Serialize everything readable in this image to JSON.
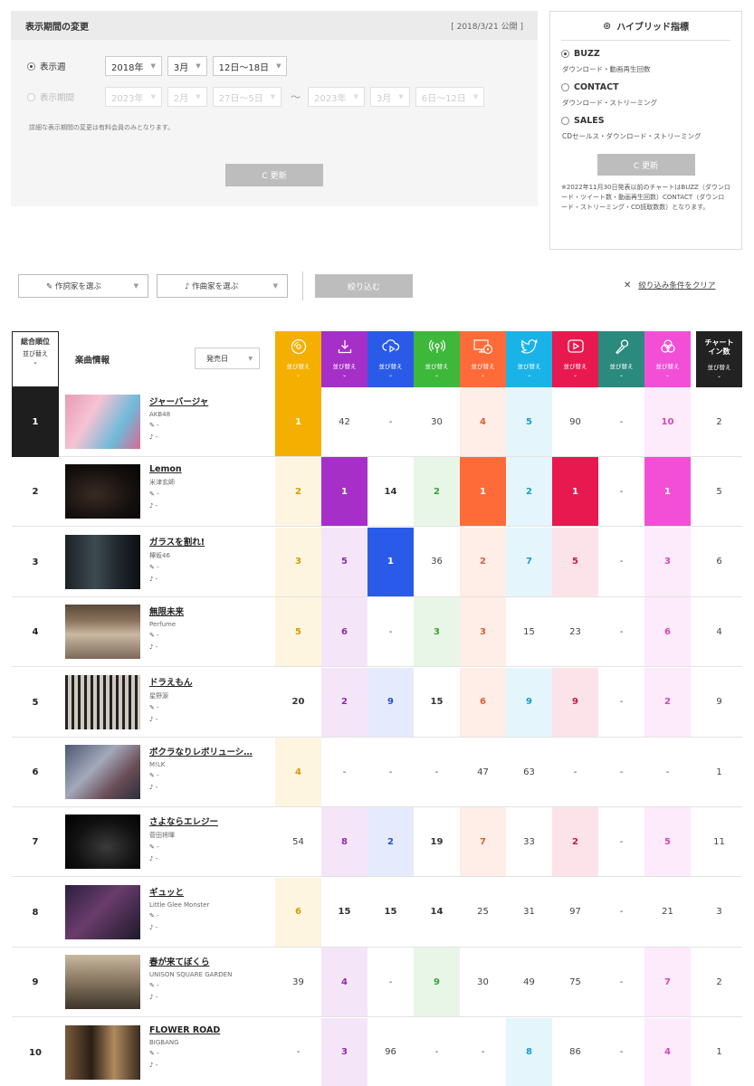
{
  "period": {
    "title": "表示期間の変更",
    "published": "[ 2018/3/21 公開 ]",
    "week_label": "表示週",
    "year": "2018年",
    "month": "3月",
    "week": "12日〜18日",
    "range_label": "表示期間",
    "range_from_year": "2023年",
    "range_from_month": "2月",
    "range_from_days": "27日〜5日",
    "tilde": "〜",
    "range_to_year": "2023年",
    "range_to_month": "3月",
    "range_to_days": "6日〜12日",
    "note": "詳細な表示期間の変更は有料会員のみとなります。",
    "update": "C 更新"
  },
  "hybrid": {
    "title": "ハイブリッド指標",
    "options": [
      {
        "label": "BUZZ",
        "desc": "ダウンロード・動画再生回数",
        "selected": true
      },
      {
        "label": "CONTACT",
        "desc": "ダウンロード・ストリーミング",
        "selected": false
      },
      {
        "label": "SALES",
        "desc": "CDセールス・ダウンロード・ストリーミング",
        "selected": false
      }
    ],
    "update": "C 更新",
    "note": "※2022年11月30日発表以前のチャートはBUZZ（ダウンロード・ツイート数・動画再生回数）CONTACT（ダウンロード・ストリーミング・CD読取数数）となります。"
  },
  "filters": {
    "lyricist": "作詞家を選ぶ",
    "composer": "作曲家を選ぶ",
    "apply": "絞り込む",
    "clear": "絞り込み条件をクリア"
  },
  "table": {
    "rank_header": "総合順位",
    "sort_label": "並び替え",
    "info_header": "楽曲情報",
    "release_sort": "発売日",
    "chart_in": "チャートイン数",
    "metrics": [
      {
        "name": "cd-sales",
        "icon": "disc-icon",
        "color": "#F5AF00"
      },
      {
        "name": "download",
        "icon": "download-icon",
        "color": "#A62FC8"
      },
      {
        "name": "streaming",
        "icon": "cloud-play-icon",
        "color": "#2A5BE8"
      },
      {
        "name": "radio",
        "icon": "radio-icon",
        "color": "#3DB83B"
      },
      {
        "name": "pc-read",
        "icon": "pc-disc-icon",
        "color": "#FF6B38"
      },
      {
        "name": "twitter",
        "icon": "bird-icon",
        "color": "#1AB3E8"
      },
      {
        "name": "video",
        "icon": "play-icon",
        "color": "#E8194E"
      },
      {
        "name": "karaoke",
        "icon": "mic-icon",
        "color": "#2A8A7D"
      },
      {
        "name": "gyao",
        "icon": "disc-cluster-icon",
        "color": "#F24FD6"
      },
      {
        "name": "chart-in",
        "icon": "",
        "color": "#222222"
      }
    ],
    "rows": [
      {
        "rank": "1",
        "title": "ジャーバージャ",
        "artist": "AKB48",
        "vals": [
          "1",
          "42",
          "-",
          "30",
          "4",
          "5",
          "90",
          "-",
          "10",
          "2"
        ]
      },
      {
        "rank": "2",
        "title": "Lemon",
        "artist": "米津玄師",
        "vals": [
          "2",
          "1",
          "14",
          "2",
          "1",
          "2",
          "1",
          "-",
          "1",
          "5"
        ]
      },
      {
        "rank": "3",
        "title": "ガラスを割れ!",
        "artist": "欅坂46",
        "vals": [
          "3",
          "5",
          "1",
          "36",
          "2",
          "7",
          "5",
          "-",
          "3",
          "6"
        ]
      },
      {
        "rank": "4",
        "title": "無限未来",
        "artist": "Perfume",
        "vals": [
          "5",
          "6",
          "-",
          "3",
          "3",
          "15",
          "23",
          "-",
          "6",
          "4"
        ]
      },
      {
        "rank": "5",
        "title": "ドラえもん",
        "artist": "星野源",
        "vals": [
          "20",
          "2",
          "9",
          "15",
          "6",
          "9",
          "9",
          "-",
          "2",
          "9"
        ]
      },
      {
        "rank": "6",
        "title": "ボクラなりレボリューシ…",
        "artist": "M!LK",
        "vals": [
          "4",
          "-",
          "-",
          "-",
          "47",
          "63",
          "-",
          "-",
          "-",
          "1"
        ]
      },
      {
        "rank": "7",
        "title": "さよならエレジー",
        "artist": "菅田将暉",
        "vals": [
          "54",
          "8",
          "2",
          "19",
          "7",
          "33",
          "2",
          "-",
          "5",
          "11"
        ]
      },
      {
        "rank": "8",
        "title": "ギュッと",
        "artist": "Little Glee Monster",
        "vals": [
          "6",
          "15",
          "15",
          "14",
          "25",
          "31",
          "97",
          "-",
          "21",
          "3"
        ]
      },
      {
        "rank": "9",
        "title": "春が来てぼくら",
        "artist": "UNISON SQUARE GARDEN",
        "vals": [
          "39",
          "4",
          "-",
          "9",
          "30",
          "49",
          "75",
          "-",
          "7",
          "2"
        ]
      },
      {
        "rank": "10",
        "title": "FLOWER ROAD",
        "artist": "BIGBANG",
        "vals": [
          "-",
          "3",
          "96",
          "-",
          "-",
          "8",
          "86",
          "-",
          "4",
          "1"
        ]
      }
    ],
    "lyric_mark": "✎ -",
    "music_mark": "♪ -"
  }
}
